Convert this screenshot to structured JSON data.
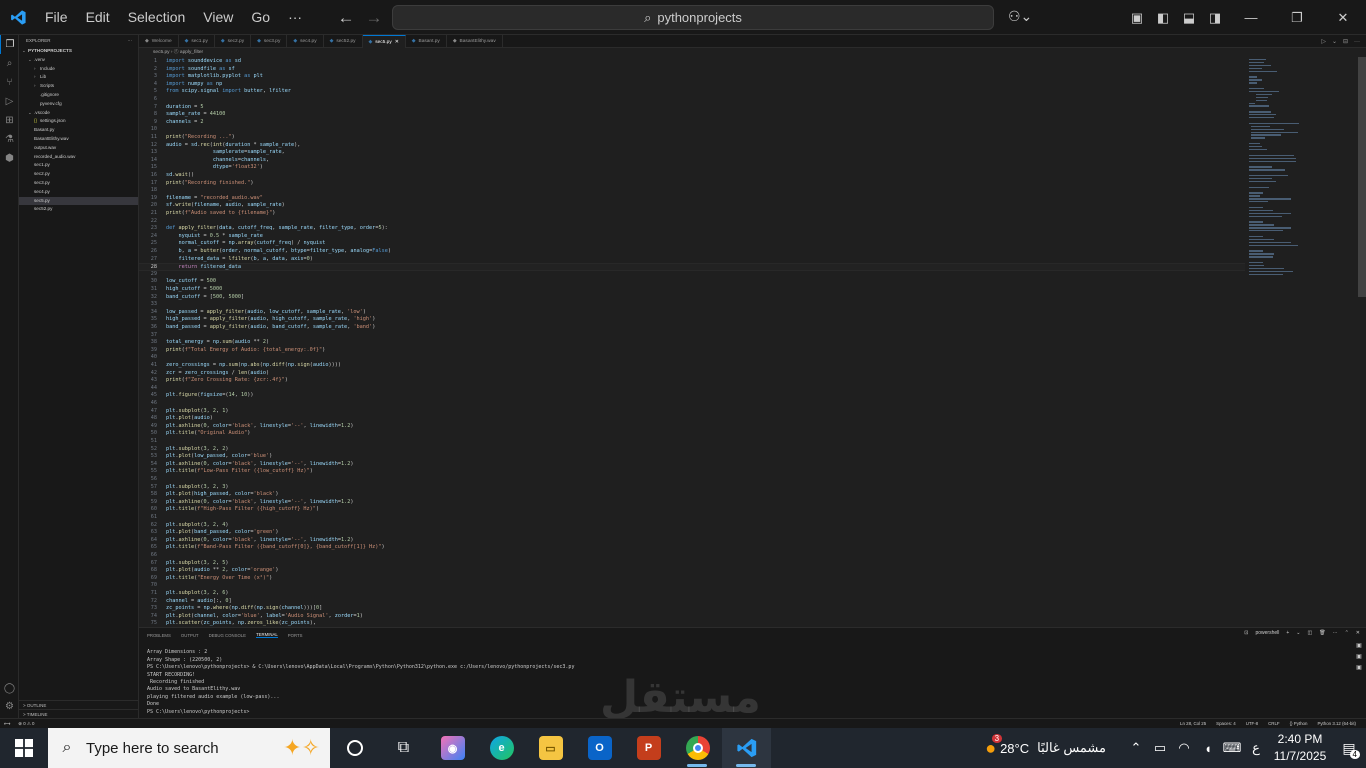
{
  "titlebar": {
    "menu": [
      "File",
      "Edit",
      "Selection",
      "View",
      "Go",
      "···"
    ],
    "search": "pythonprojects"
  },
  "sidebar": {
    "header": "EXPLORER",
    "header_more": "···",
    "items": [
      {
        "label": "PYTHONPROJECTS",
        "indent": 0,
        "icon": "chevron-down",
        "bold": true
      },
      {
        "label": ".venv",
        "indent": 1,
        "icon": "chevron-down"
      },
      {
        "label": "Include",
        "indent": 2,
        "icon": "chevron-right"
      },
      {
        "label": "Lib",
        "indent": 2,
        "icon": "chevron-right"
      },
      {
        "label": "Scripts",
        "indent": 2,
        "icon": "chevron-right"
      },
      {
        "label": ".gitignore",
        "indent": 2,
        "icon": ""
      },
      {
        "label": "pyvenv.cfg",
        "indent": 2,
        "icon": ""
      },
      {
        "label": ".vscode",
        "indent": 1,
        "icon": "chevron-down"
      },
      {
        "label": "settings.json",
        "indent": 2,
        "icon": "{}"
      },
      {
        "label": "Basant.py",
        "indent": 1,
        "icon": ""
      },
      {
        "label": "BasantElithy.wav",
        "indent": 1,
        "icon": ""
      },
      {
        "label": "output.wav",
        "indent": 1,
        "icon": ""
      },
      {
        "label": "recorded_audio.wav",
        "indent": 1,
        "icon": ""
      },
      {
        "label": "sec1.py",
        "indent": 1,
        "icon": ""
      },
      {
        "label": "sec2.py",
        "indent": 1,
        "icon": ""
      },
      {
        "label": "sec3.py",
        "indent": 1,
        "icon": ""
      },
      {
        "label": "sec4.py",
        "indent": 1,
        "icon": ""
      },
      {
        "label": "sec5.py",
        "indent": 1,
        "icon": "",
        "selected": true
      },
      {
        "label": "sec52.py",
        "indent": 1,
        "icon": ""
      }
    ],
    "footer": [
      ">  OUTLINE",
      ">  TIMELINE"
    ]
  },
  "tabs": [
    {
      "label": "Welcome"
    },
    {
      "label": "sec1.py"
    },
    {
      "label": "sec2.py"
    },
    {
      "label": "sec3.py"
    },
    {
      "label": "sec4.py"
    },
    {
      "label": "sec52.py"
    },
    {
      "label": "sec5.py",
      "active": true
    },
    {
      "label": "Basant.py"
    },
    {
      "label": "BasantElithy.wav"
    }
  ],
  "tab_actions": [
    "▷",
    "⌄",
    "⊟",
    "···"
  ],
  "breadcrumb": "sec5.py › ⓕ apply_filter",
  "editor": {
    "current_line": 28,
    "lines": [
      "import sounddevice as sd",
      "import soundfile as sf",
      "import matplotlib.pyplot as plt",
      "import numpy as np",
      "from scipy.signal import butter, lfilter",
      "",
      "duration = 5",
      "sample_rate = 44100",
      "channels = 2",
      "",
      "print(\"Recording ...\")",
      "audio = sd.rec(int(duration * sample_rate),",
      "               samplerate=sample_rate,",
      "               channels=channels,",
      "               dtype='float32')",
      "sd.wait()",
      "print(\"Recording finished.\")",
      "",
      "filename = \"recorded_audio.wav\"",
      "sf.write(filename, audio, sample_rate)",
      "print(f\"Audio saved to {filename}\")",
      "",
      "def apply_filter(data, cutoff_freq, sample_rate, filter_type, order=5):",
      "    nyquist = 0.5 * sample_rate",
      "    normal_cutoff = np.array(cutoff_freq) / nyquist",
      "    b, a = butter(order, normal_cutoff, btype=filter_type, analog=False)",
      "    filtered_data = lfilter(b, a, data, axis=0)",
      "    return filtered_data",
      "",
      "low_cutoff = 500",
      "high_cutoff = 5000",
      "band_cutoff = [500, 5000]",
      "",
      "low_passed = apply_filter(audio, low_cutoff, sample_rate, 'low')",
      "high_passed = apply_filter(audio, high_cutoff, sample_rate, 'high')",
      "band_passed = apply_filter(audio, band_cutoff, sample_rate, 'band')",
      "",
      "total_energy = np.sum(audio ** 2)",
      "print(f\"Total Energy of Audio: {total_energy:.0f}\")",
      "",
      "zero_crossings = np.sum(np.abs(np.diff(np.sign(audio))))",
      "zcr = zero_crossings / len(audio)",
      "print(f\"Zero Crossing Rate: {zcr:.4f}\")",
      "",
      "plt.figure(figsize=(14, 10))",
      "",
      "plt.subplot(3, 2, 1)",
      "plt.plot(audio)",
      "plt.axhline(0, color='black', linestyle='--', linewidth=1.2)",
      "plt.title(\"Original Audio\")",
      "",
      "plt.subplot(3, 2, 2)",
      "plt.plot(low_passed, color='blue')",
      "plt.axhline(0, color='black', linestyle='--', linewidth=1.2)",
      "plt.title(f\"Low-Pass Filter ({low_cutoff} Hz)\")",
      "",
      "plt.subplot(3, 2, 3)",
      "plt.plot(high_passed, color='black')",
      "plt.axhline(0, color='black', linestyle='--', linewidth=1.2)",
      "plt.title(f\"High-Pass Filter ({high_cutoff} Hz)\")",
      "",
      "plt.subplot(3, 2, 4)",
      "plt.plot(band_passed, color='green')",
      "plt.axhline(0, color='black', linestyle='--', linewidth=1.2)",
      "plt.title(f\"Band-Pass Filter ({band_cutoff[0]}, {band_cutoff[1]} Hz)\")",
      "",
      "plt.subplot(3, 2, 5)",
      "plt.plot(audio ** 2, color='orange')",
      "plt.title(\"Energy Over Time (x²)\")",
      "",
      "plt.subplot(3, 2, 6)",
      "channel = audio[:, 0]",
      "zc_points = np.where(np.diff(np.sign(channel)))[0]",
      "plt.plot(channel, color='blue', label='Audio Signal', zorder=1)",
      "plt.scatter(zc_points, np.zeros_like(zc_points),"
    ]
  },
  "panel": {
    "tabs": [
      "PROBLEMS",
      "OUTPUT",
      "DEBUG CONSOLE",
      "TERMINAL",
      "PORTS"
    ],
    "active_tab": "TERMINAL",
    "shell": "powershell",
    "terminal_lines": [
      "",
      "Array Dimensions : 2",
      "Array Shape : (220500, 2)",
      "PS C:\\Users\\lenovo\\pythonprojects> & C:\\Users\\lenovo\\AppData\\Local\\Programs\\Python\\Python312\\python.exe c:/Users/lenovo/pythonprojects/sec3.py",
      "START RECORDING!",
      " Recording finished",
      "Audio saved to BasantElithy.wav",
      "playing filtered audio example (low-pass)...",
      "Done",
      "PS C:\\Users\\lenovo\\pythonprojects>"
    ]
  },
  "watermark": "مستقل",
  "statusbar": {
    "left": [
      "⊗ 0 ⚠ 0"
    ],
    "right": [
      "Ln 28, Col 25",
      "Spaces: 4",
      "UTF-8",
      "CRLF",
      "{} Python",
      "Python 3.12 (64-bit)"
    ]
  },
  "taskbar": {
    "search_placeholder": "Type here to search",
    "weather_badge": "3",
    "temperature": "28°C",
    "weather_text": "مشمس غالبًا",
    "language": "ع",
    "time": "2:40 PM",
    "date": "11/7/2025",
    "notifications": "4"
  },
  "colors": {
    "keyword": "#569cd6",
    "control": "#c586c0",
    "function": "#dcdcaa",
    "string": "#ce9178",
    "number": "#b5cea8",
    "variable": "#9cdcfe",
    "accent": "#0078d4"
  }
}
